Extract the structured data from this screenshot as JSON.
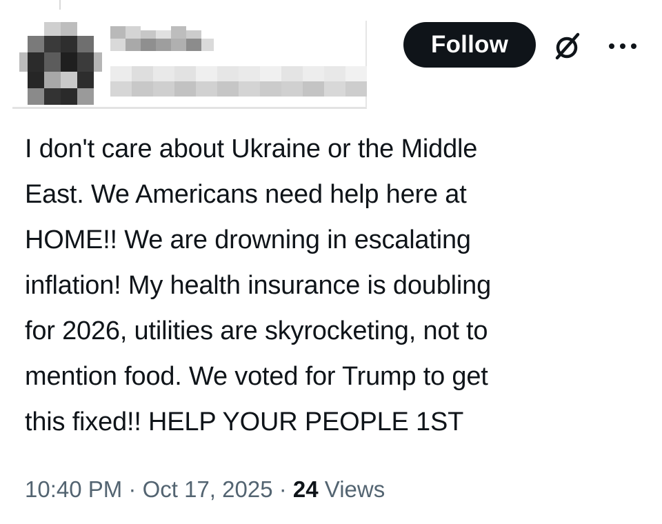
{
  "post": {
    "author": {
      "name_redacted": true,
      "handle_redacted": true,
      "avatar_icon": "pixelated-avatar"
    },
    "follow_label": "Follow",
    "grok_icon": "grok-slash-circle-icon",
    "more_icon": "more-horizontal-icon",
    "text": "I don't care about Ukraine or the Middle\nEast.  We Americans need help here at\nHOME!!  We are drowning in escalating\ninflation!  My health insurance is doubling\nfor 2026, utilities are skyrocketing, not to\nmention food.  We voted for Trump to get\nthis fixed!! HELP YOUR PEOPLE 1ST",
    "time": "10:40 PM",
    "separator": "·",
    "date": "Oct 17, 2025",
    "views_count": "24",
    "views_label": "Views"
  },
  "colors": {
    "button_bg": "#0f1419",
    "text": "#0f1419",
    "meta": "#536471"
  }
}
